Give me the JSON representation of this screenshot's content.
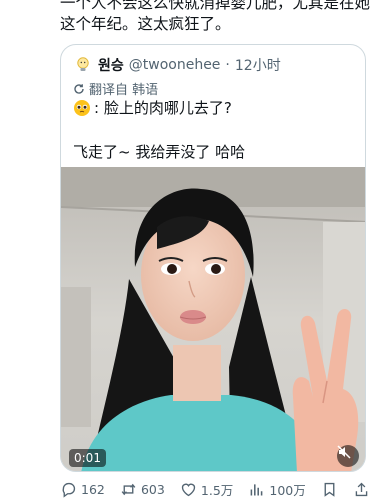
{
  "post": {
    "line1": "一个人不会这么快就消掉婴儿肥，尤其是在她",
    "line2": "这个年纪。这太疯狂了。"
  },
  "quote": {
    "avatar_icon": "lightbulb-icon",
    "name": "원승",
    "handle": "@twoonehee",
    "dot": "·",
    "time": "12小时",
    "translated_label": "翻译自 韩语",
    "line1_emoji": "pleading-face-emoji",
    "line1": ": 脸上的肉哪儿去了?",
    "line2": "飞走了~ 我给弄没了 哈哈"
  },
  "video": {
    "timestamp": "0:01"
  },
  "actions": {
    "replies": "162",
    "reposts": "603",
    "likes": "1.5万",
    "views": "100万"
  },
  "colors": {
    "text": "#0f1419",
    "muted": "#536471",
    "border": "#cfd9de"
  }
}
